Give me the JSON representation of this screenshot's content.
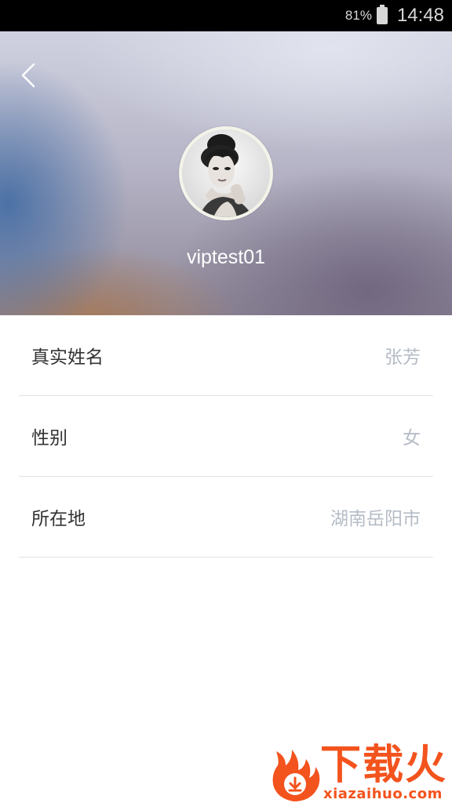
{
  "status_bar": {
    "battery": "81%",
    "time": "14:48"
  },
  "header": {
    "back_icon": "chevron-left-icon",
    "username": "viptest01",
    "avatar_icon": "portrait-photo"
  },
  "profile_fields": [
    {
      "label": "真实姓名",
      "value": "张芳"
    },
    {
      "label": "性别",
      "value": "女"
    },
    {
      "label": "所在地",
      "value": "湖南岳阳市"
    }
  ],
  "watermark": {
    "title": "下载火",
    "url": "xiazaihuo.com",
    "color": "#f3531d"
  },
  "colors": {
    "label": "#333333",
    "value": "#b5bcc6",
    "divider": "#e3e3e3"
  }
}
